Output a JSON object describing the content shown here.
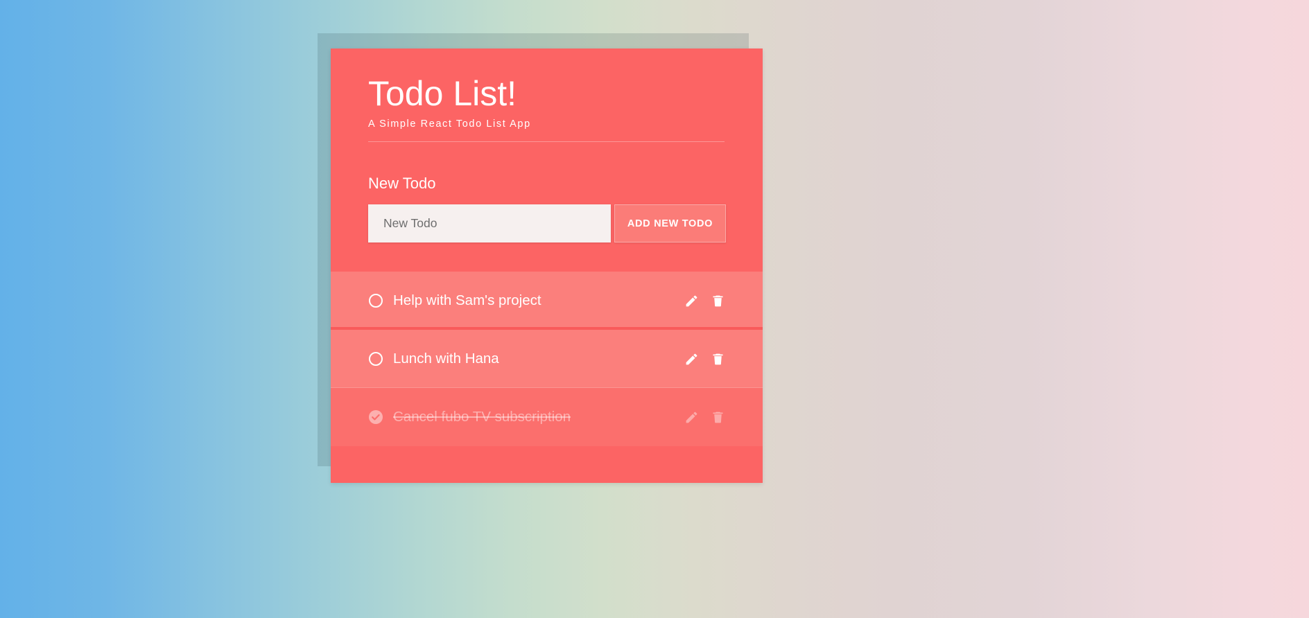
{
  "theme": {
    "card_background": "#fc6464",
    "row_background": "#fb7f7c",
    "row_done_background": "#fb6f6d",
    "divider": "#f95a5a",
    "input_background": "#f6f0ef",
    "button_background": "#fb7c78",
    "text_on_card": "#ffffff",
    "gradient_left": "#63b1e8",
    "gradient_right": "#f6d7dc"
  },
  "header": {
    "title": "Todo List!",
    "subtitle": "A Simple React Todo List App"
  },
  "form": {
    "label": "New Todo",
    "input_value": "",
    "input_placeholder": "New Todo",
    "add_button_label": "ADD NEW TODO"
  },
  "todos": [
    {
      "text": "Help with Sam's project",
      "completed": false,
      "check_icon": "circle-outline-icon",
      "edit_icon": "pencil-icon",
      "delete_icon": "trash-icon"
    },
    {
      "text": "Lunch with Hana",
      "completed": false,
      "check_icon": "circle-outline-icon",
      "edit_icon": "pencil-icon",
      "delete_icon": "trash-icon"
    },
    {
      "text": "Cancel fubo TV subscription",
      "completed": true,
      "check_icon": "check-circle-filled-icon",
      "edit_icon": "pencil-icon",
      "delete_icon": "trash-icon"
    }
  ]
}
